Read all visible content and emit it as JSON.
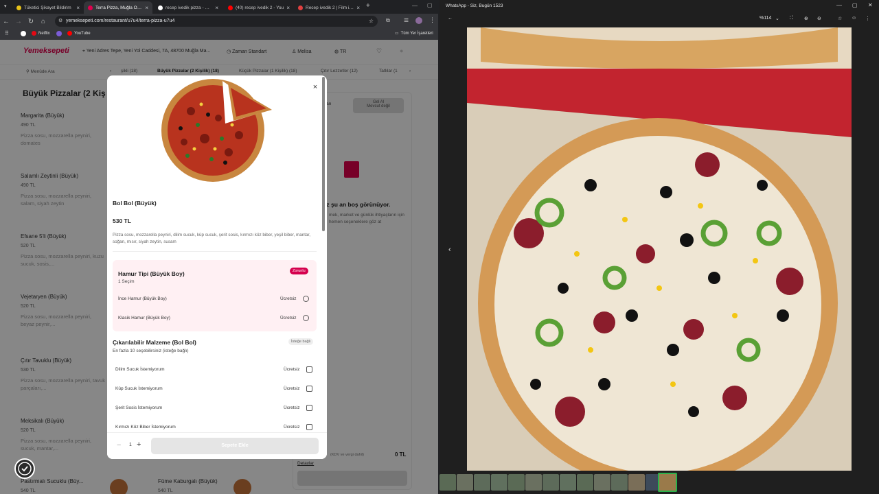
{
  "browser": {
    "tabs": [
      {
        "title": "Tüketici Şikayet Bildirim",
        "color": "#e8c21a"
      },
      {
        "title": "Terra Pizza, Muğla Onlin",
        "color": "#e0004d",
        "active": true
      },
      {
        "title": "recep ivedik pizza - Goo",
        "color": "#ffffff"
      },
      {
        "title": "(40) recep ivedik 2 - You",
        "color": "#ff0000"
      },
      {
        "title": "Recep ivedik 2 | Film izle",
        "color": "#e04040"
      }
    ],
    "new_tab": "+",
    "url": "yemeksepeti.com/restaurant/u7u4/terra-pizza-u7u4",
    "bookmarks": {
      "netflix": "Netflix",
      "youtube": "YouTube",
      "all_bookmarks": "Tüm Yer İşaretleri"
    }
  },
  "site": {
    "logo": "Yemeksepeti",
    "address": "Yeni Adres Tepe, Yeni Yol Caddesi, 7A, 48700 Muğla Ma...",
    "time": "Zaman Standart",
    "user": "Melisa",
    "lang": "TR",
    "search_placeholder": "Menüde Ara",
    "categories": [
      "şikli (18)",
      "Büyük Pizzalar (2 Kişilik) (18)",
      "Küçük Pizzalar (1 Kişilik) (18)",
      "Çıtır Lezzetler (12)",
      "Tatlılar (1"
    ],
    "section_title": "Büyük Pizzalar (2 Kiş",
    "menu_items": [
      {
        "name": "Margarita (Büyük)",
        "price": "490 TL",
        "desc": "Pizza sosu, mozzarella peyniri, domates"
      },
      {
        "name": "Salamlı Zeytinli (Büyük)",
        "price": "490 TL",
        "desc": "Pizza sosu, mozzarella peyniri, salam, siyah zeytin"
      },
      {
        "name": "Efsane 5'li (Büyük)",
        "price": "520 TL",
        "desc": "Pizza sosu, mozzarella peyniri, kuzu sucuk, sosis,..."
      },
      {
        "name": "Vejetaryen (Büyük)",
        "price": "520 TL",
        "desc": "Pizza sosu, mozzarella peyniri, beyaz peynir,..."
      },
      {
        "name": "Çıtır Tavuklu (Büyük)",
        "price": "530 TL",
        "desc": "Pizza sosu, mozzarella peyniri, tavuk parçaları,..."
      },
      {
        "name": "Meksikalı (Büyük)",
        "price": "520 TL",
        "desc": "Pizza sosu, mozzarella peyniri, sucuk, mantar,..."
      },
      {
        "name": "Pastırmalı Sucuklu (Büy...",
        "price": "540 TL",
        "desc": ""
      }
    ],
    "menu_items_right": [
      {
        "name": "Füme Kaburgalı (Büyük)",
        "price": "540 TL"
      }
    ],
    "cart": {
      "delivery_tab": "ran",
      "pickup_tab": "Gel Al",
      "pickup_sub": "Mevcut değil",
      "empty_title": "ız şu an boş görünüyor.",
      "empty_text": "mek, market ve günlük ihtiyaçların için hemen seçeneklere göz at",
      "total_label": "(KDV ve vergi dahil)",
      "total": "0 TL",
      "details_link": "Detaylar"
    }
  },
  "modal": {
    "close": "×",
    "item_name": "Bol Bol (Büyük)",
    "price": "530 TL",
    "description": "Pizza sosu, mozzarella peyniri, dilim sucuk, küp sucuk, şerit sosis, kırmızı köz biber, yeşil biber, mantar, soğan, mısır, siyah zeytin, susam",
    "group1": {
      "title": "Hamur Tipi (Büyük Boy)",
      "subtitle": "1 Seçim",
      "badge": "Zorunlu",
      "options": [
        {
          "label": "İnce Hamur (Büyük Boy)",
          "price": "Ücretsiz"
        },
        {
          "label": "Klasik Hamur (Büyük Boy)",
          "price": "Ücretsiz"
        }
      ]
    },
    "group2": {
      "title": "Çıkarılabilir Malzeme (Bol Bol)",
      "subtitle": "En fazla 10 seçebilirsiniz (isteğe bağlı)",
      "badge": "İsteğe bağlı",
      "options": [
        {
          "label": "Dilim Sucuk İstemiyorum",
          "price": "Ücretsiz"
        },
        {
          "label": "Küp Sucuk İstemiyorum",
          "price": "Ücretsiz"
        },
        {
          "label": "Şerit Sosis İstemiyorum",
          "price": "Ücretsiz"
        },
        {
          "label": "Kırmızı Köz Biber İstemiyorum",
          "price": "Ücretsiz"
        }
      ]
    },
    "quantity": "1",
    "minus": "−",
    "plus": "+",
    "add_button": "Sepete Ekle"
  },
  "viewer": {
    "title": "WhatsApp - Siz, Bugün 1523",
    "zoom": "%114",
    "back": "←",
    "prev": "‹"
  },
  "colors": {
    "brand": "#e0004d",
    "required_badge": "#d5004d"
  }
}
